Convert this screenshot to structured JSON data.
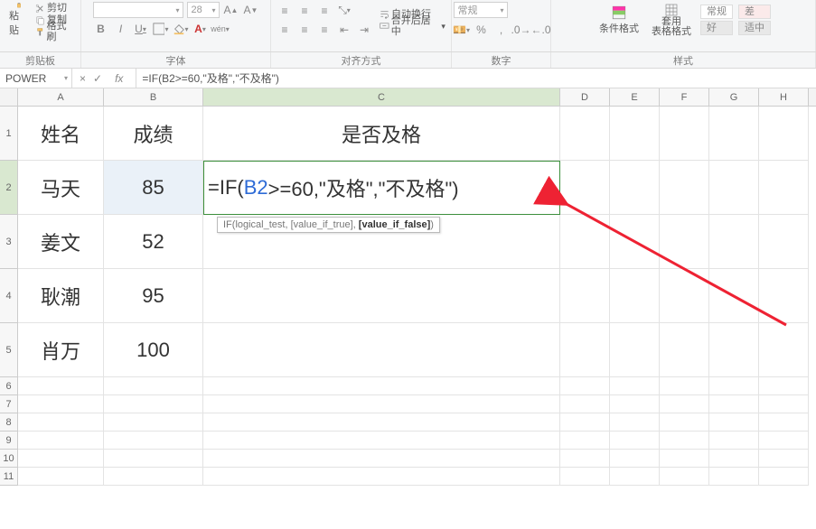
{
  "ribbon": {
    "clipboard": {
      "paste": "粘贴",
      "cut": "剪切",
      "copy": "复制",
      "format_painter": "格式刷",
      "group_label": "剪贴板"
    },
    "font": {
      "font_name": "",
      "font_size": "28",
      "group_label": "字体"
    },
    "align": {
      "wrap": "自动换行",
      "merge": "合并后居中",
      "group_label": "对齐方式"
    },
    "number": {
      "selector": "常规",
      "group_label": "数字"
    },
    "styles": {
      "cond": "条件格式",
      "table": "套用\n表格格式",
      "normal": "常规",
      "bad": "差",
      "good": "好",
      "neutral": "适中",
      "group_label": "样式"
    }
  },
  "fbar": {
    "name": "POWER",
    "cancel": "×",
    "accept": "✓",
    "fx": "fx",
    "formula": "=IF(B2>=60,\"及格\",\"不及格\")"
  },
  "columns": [
    "A",
    "B",
    "C",
    "D",
    "E",
    "F",
    "G",
    "H"
  ],
  "data": {
    "header": {
      "name": "姓名",
      "score": "成绩",
      "pass": "是否及格"
    },
    "rows": [
      {
        "name": "马天",
        "score": "85"
      },
      {
        "name": "姜文",
        "score": "52"
      },
      {
        "name": "耿潮",
        "score": "95"
      },
      {
        "name": "肖万",
        "score": "100"
      }
    ]
  },
  "editor": {
    "prefix": "=IF(",
    "ref": "B2",
    "suffix": ">=60,\"及格\",\"不及格\")"
  },
  "tooltip": {
    "fn": "IF(logical_test, [value_if_true], ",
    "bold": "[value_if_false]",
    "end": ")"
  },
  "row_nums": [
    "1",
    "2",
    "3",
    "4",
    "5",
    "6",
    "7",
    "8",
    "9",
    "10",
    "11"
  ]
}
